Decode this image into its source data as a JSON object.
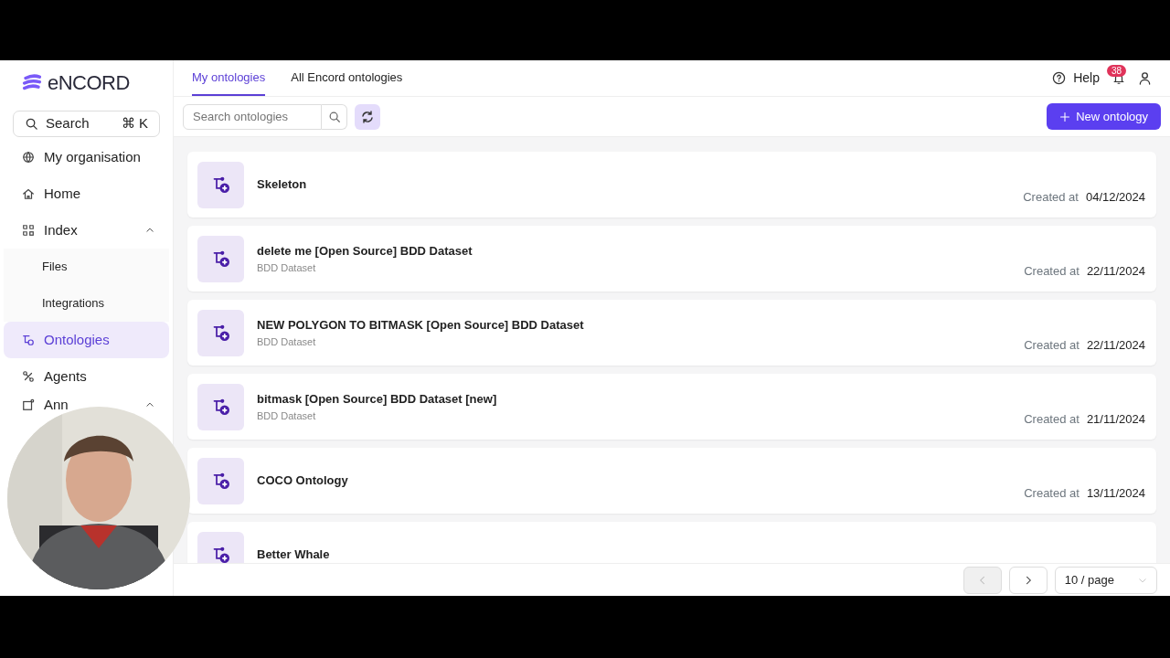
{
  "brand": {
    "name": "eNCORD"
  },
  "search": {
    "label": "Search",
    "shortcut": "⌘ K"
  },
  "sidebar": {
    "items": [
      {
        "label": "My organisation",
        "selected": false
      },
      {
        "label": "Home",
        "selected": false
      },
      {
        "label": "Index",
        "selected": false,
        "expanded": true,
        "children": [
          {
            "label": "Files",
            "selected": false
          },
          {
            "label": "Integrations",
            "selected": false
          }
        ]
      },
      {
        "label": "Ontologies",
        "selected": true
      },
      {
        "label": "Agents",
        "selected": false
      },
      {
        "label": "Ann",
        "selected": false,
        "expanded": true
      }
    ]
  },
  "tabs": [
    {
      "label": "My ontologies",
      "selected": true
    },
    {
      "label": "All Encord ontologies",
      "selected": false
    }
  ],
  "header": {
    "help": "Help",
    "notifications": "38"
  },
  "toolbar": {
    "search_placeholder": "Search ontologies",
    "new_button": "New ontology"
  },
  "rows": [
    {
      "title": "Skeleton",
      "created_label": "Created at",
      "date": "04/12/2024"
    },
    {
      "title": "delete me [Open Source] BDD Dataset",
      "subtitle": "BDD Dataset",
      "created_label": "Created at",
      "date": "22/11/2024"
    },
    {
      "title": "NEW POLYGON TO BITMASK [Open Source] BDD Dataset",
      "subtitle": "BDD Dataset",
      "created_label": "Created at",
      "date": "22/11/2024"
    },
    {
      "title": "bitmask [Open Source] BDD Dataset [new]",
      "subtitle": "BDD Dataset",
      "created_label": "Created at",
      "date": "21/11/2024"
    },
    {
      "title": "COCO Ontology",
      "created_label": "Created at",
      "date": "13/11/2024"
    },
    {
      "title": "Better Whale"
    }
  ],
  "pagination": {
    "prev_disabled": true,
    "next_disabled": false,
    "page_size": "10 / page"
  }
}
